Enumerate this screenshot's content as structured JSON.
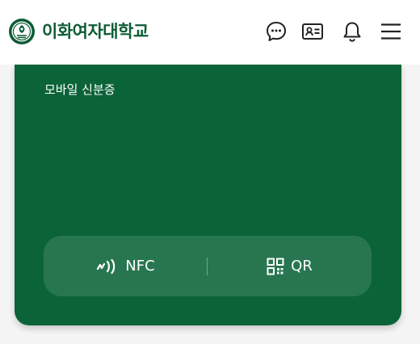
{
  "header": {
    "brand_name": "이화여자대학교",
    "icons": [
      "chat-bubble-icon",
      "id-card-icon",
      "bell-icon",
      "menu-icon"
    ]
  },
  "card": {
    "title": "모바일 신분증",
    "actions": [
      {
        "label": "NFC",
        "icon": "nfc-icon"
      },
      {
        "label": "QR",
        "icon": "qr-code-icon"
      }
    ]
  },
  "colors": {
    "brand_green": "#0b6338",
    "header_text": "#0d5c35",
    "background": "#f4f4f4"
  }
}
